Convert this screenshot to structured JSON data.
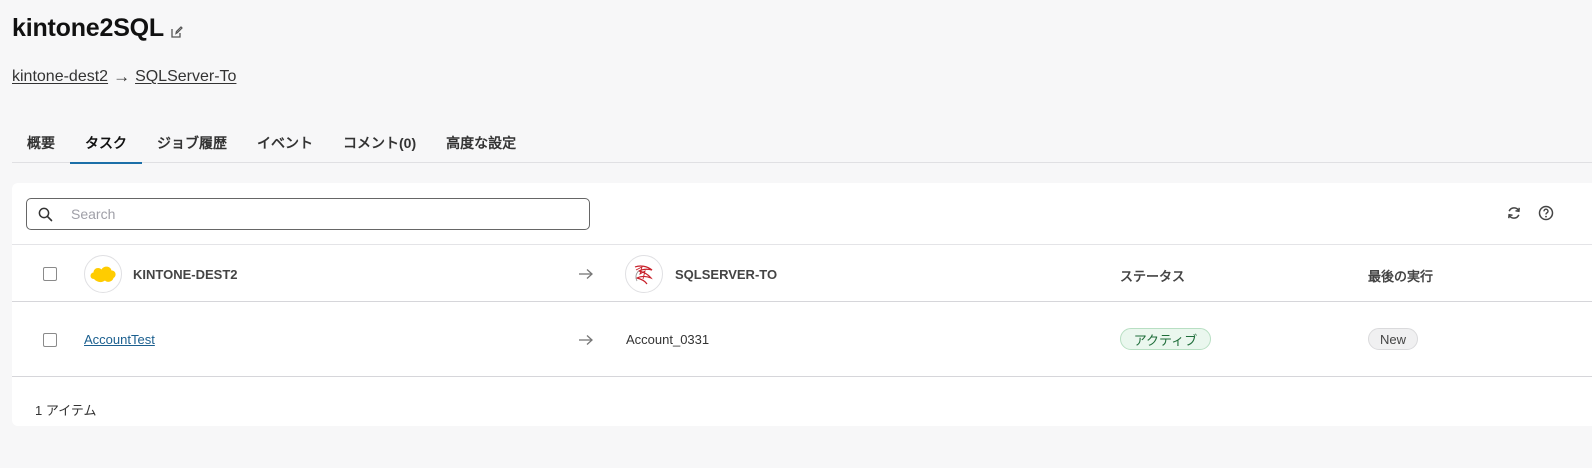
{
  "header": {
    "title": "kintone2SQL",
    "edit_icon": "edit-icon"
  },
  "breadcrumb": {
    "source": "kintone-dest2",
    "separator": "→",
    "destination": "SQLServer-To"
  },
  "tabs": [
    {
      "label": "概要",
      "active": false
    },
    {
      "label": "タスク",
      "active": true
    },
    {
      "label": "ジョブ履歴",
      "active": false
    },
    {
      "label": "イベント",
      "active": false
    },
    {
      "label": "コメント(0)",
      "active": false
    },
    {
      "label": "高度な設定",
      "active": false
    }
  ],
  "search": {
    "placeholder": "Search",
    "value": ""
  },
  "toolbar": {
    "refresh_icon": "refresh-icon",
    "help_icon": "help-icon"
  },
  "table": {
    "headers": {
      "source": "KINTONE-DEST2",
      "destination": "SQLSERVER-TO",
      "status": "ステータス",
      "last_run": "最後の実行"
    },
    "rows": [
      {
        "source": "AccountTest",
        "destination": "Account_0331",
        "status": "アクティブ",
        "last_run": "New"
      }
    ]
  },
  "footer": {
    "count": "1 アイテム"
  },
  "colors": {
    "accent": "#1b6fa8",
    "link": "#1b5f8f",
    "active_badge_bg": "#eaf7ee",
    "active_badge_text": "#1f6d3a",
    "kintone_yellow": "#ffcc00",
    "sqlserver_red": "#c8202a"
  }
}
